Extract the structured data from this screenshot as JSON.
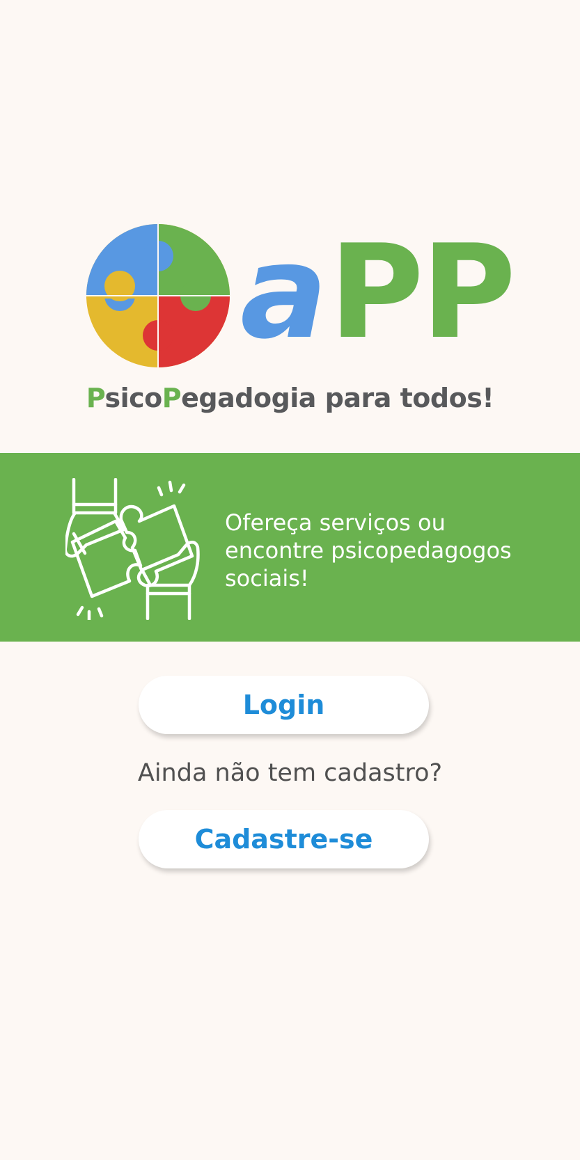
{
  "colors": {
    "background": "#FDF8F4",
    "banner_green": "#6AB24F",
    "logo_blue": "#5898E2",
    "logo_green": "#6AB24F",
    "logo_yellow": "#E4B92E",
    "logo_red": "#DD3535",
    "tagline_gray": "#58595B",
    "button_text_blue": "#1E8CD8",
    "prompt_gray": "#505050"
  },
  "icons": {
    "logo": "puzzle-circle-icon",
    "banner": "hands-joining-puzzle-icon"
  },
  "logo": {
    "wordmark_a": "a",
    "wordmark_pp": "PP"
  },
  "tagline": {
    "p1": "P",
    "sico": "sico",
    "p2": "P",
    "rest": "egadogia para todos!"
  },
  "banner": {
    "line1": "Ofereça serviços ou",
    "line2": "encontre psicopedagogos",
    "line3": "sociais!"
  },
  "auth": {
    "login_label": "Login",
    "no_account_prompt": "Ainda não tem cadastro?",
    "signup_label": "Cadastre-se"
  }
}
